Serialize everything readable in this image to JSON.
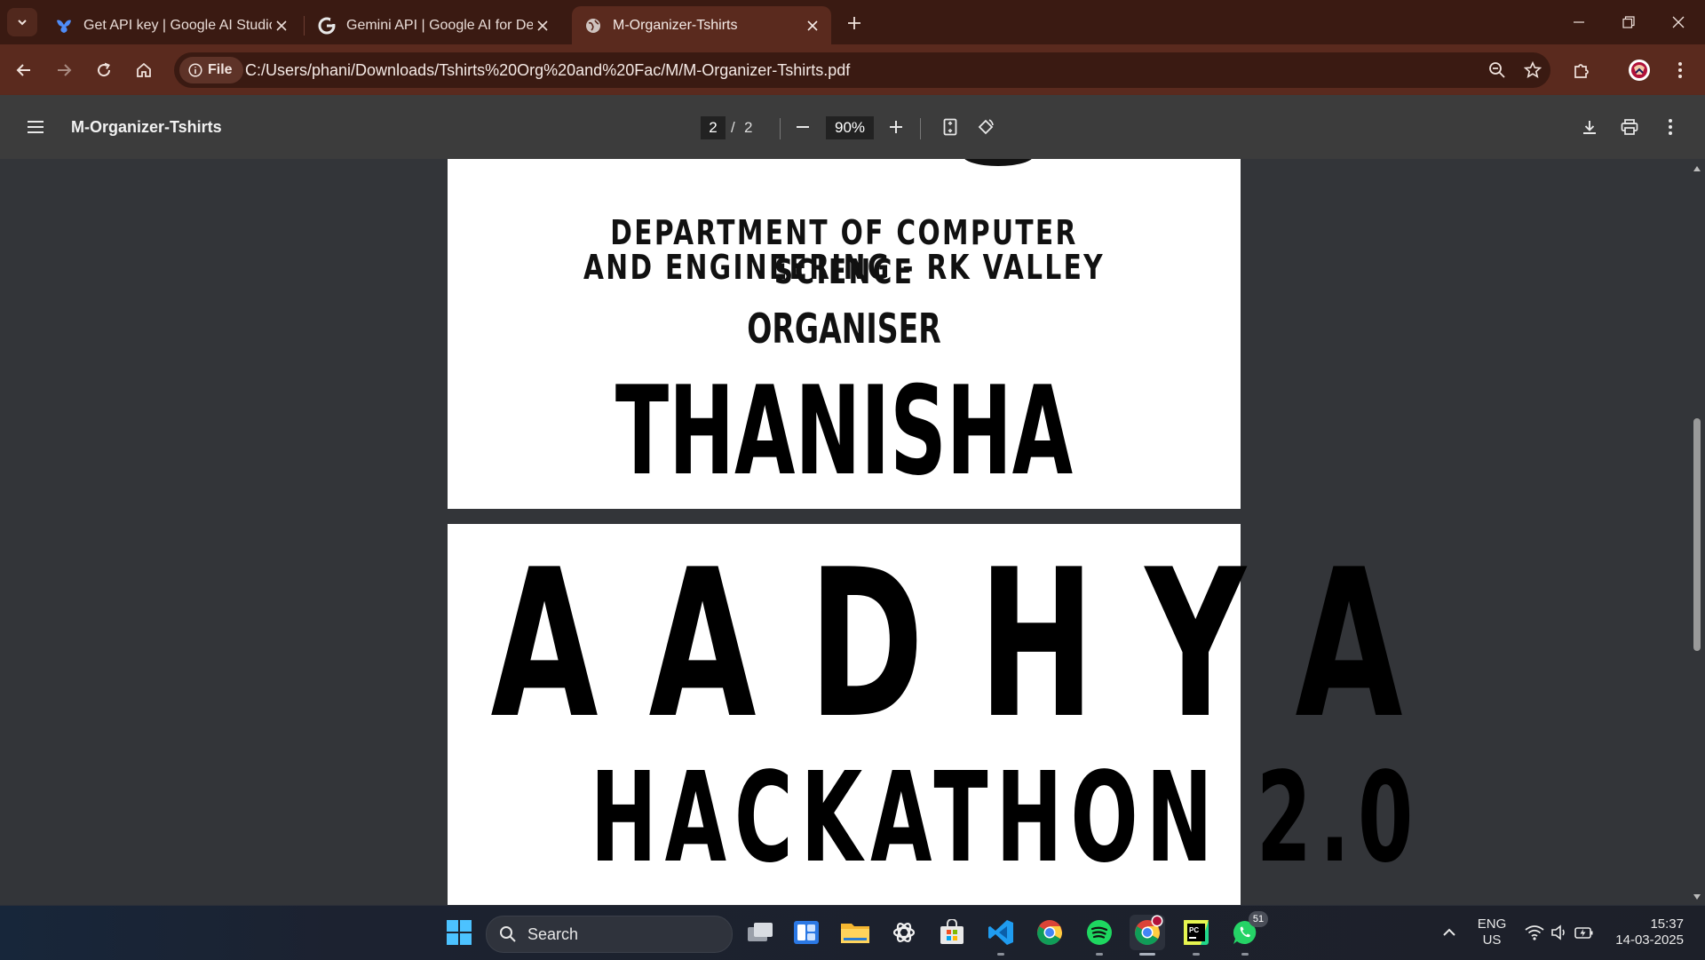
{
  "browser": {
    "tabs": [
      {
        "title": "Get API key | Google AI Studio",
        "icon": "ai-studio-icon",
        "active": false
      },
      {
        "title": "Gemini API  |  Google AI for Developers",
        "icon": "google-g-icon",
        "active": false
      },
      {
        "title": "M-Organizer-Tshirts",
        "icon": "globe-icon",
        "active": true
      }
    ],
    "address": {
      "chip_label": "File",
      "url": "C:/Users/phani/Downloads/Tshirts%20Org%20and%20Fac/M/M-Organizer-Tshirts.pdf"
    }
  },
  "pdf_viewer": {
    "title": "M-Organizer-Tshirts",
    "current_page": "2",
    "page_separator": "/",
    "total_pages": "2",
    "zoom": "90%"
  },
  "document": {
    "page1": {
      "dept_line1": "DEPARTMENT OF COMPUTER SCIENCE",
      "dept_line2": "AND ENGINEERING - RK VALLEY",
      "role": "ORGANISER",
      "name": "THANISHA"
    },
    "page2": {
      "event_letters": [
        "A",
        "A",
        "D",
        "H",
        "Y",
        "A"
      ],
      "subtitle": "HACKATHON 2.0"
    }
  },
  "taskbar": {
    "search_label": "Search",
    "whatsapp_badge": "51",
    "language": "ENG",
    "region": "US",
    "time": "15:37",
    "date": "14-03-2025"
  },
  "colors": {
    "tabstrip": "#3a1a12",
    "toolbar": "#5a2a1e",
    "pdf_toolbar": "#3c3c3c",
    "viewer_bg": "#333539"
  }
}
